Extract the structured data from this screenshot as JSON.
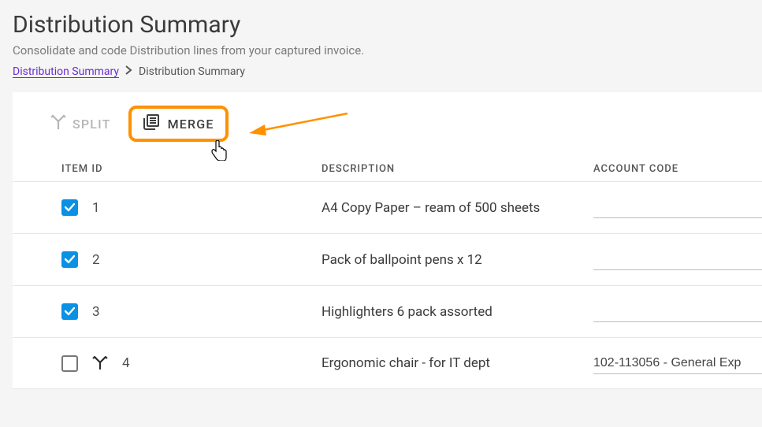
{
  "header": {
    "title": "Distribution Summary",
    "subtitle": "Consolidate and code Distribution lines from your captured invoice.",
    "breadcrumb_link": "Distribution Summary",
    "breadcrumb_current": "Distribution Summary"
  },
  "toolbar": {
    "split_label": "SPLIT",
    "merge_label": "MERGE"
  },
  "table": {
    "headers": {
      "item": "ITEM ID",
      "desc": "DESCRIPTION",
      "acct": "ACCOUNT CODE"
    },
    "rows": [
      {
        "id": "1",
        "desc": "A4 Copy Paper – ream of 500 sheets",
        "acct": "",
        "checked": true,
        "split": false
      },
      {
        "id": "2",
        "desc": "Pack of ballpoint pens x 12",
        "acct": "",
        "checked": true,
        "split": false
      },
      {
        "id": "3",
        "desc": "Highlighters 6 pack assorted",
        "acct": "",
        "checked": true,
        "split": false
      },
      {
        "id": "4",
        "desc": "Ergonomic chair - for IT dept",
        "acct": "102-113056 - General Exp",
        "checked": false,
        "split": true
      }
    ]
  },
  "colors": {
    "accent": "#ff9100",
    "link": "#6a2fcf",
    "check": "#0a91e6"
  }
}
